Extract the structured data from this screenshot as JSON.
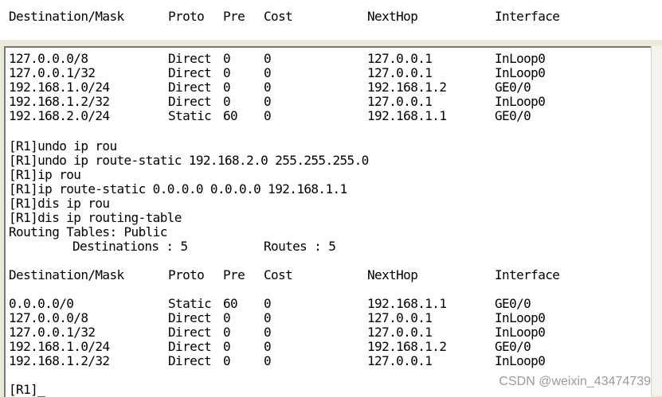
{
  "header": {
    "destination": "Destination/Mask",
    "proto": "Proto",
    "pre": "Pre",
    "cost": "Cost",
    "nexthop": "NextHop",
    "interface": "Interface"
  },
  "table1": [
    {
      "dest": "127.0.0.0/8",
      "proto": "Direct",
      "pre": "0",
      "cost": "0",
      "nexthop": "127.0.0.1",
      "iface": "InLoop0"
    },
    {
      "dest": "127.0.0.1/32",
      "proto": "Direct",
      "pre": "0",
      "cost": "0",
      "nexthop": "127.0.0.1",
      "iface": "InLoop0"
    },
    {
      "dest": "192.168.1.0/24",
      "proto": "Direct",
      "pre": "0",
      "cost": "0",
      "nexthop": "192.168.1.2",
      "iface": "GE0/0"
    },
    {
      "dest": "192.168.1.2/32",
      "proto": "Direct",
      "pre": "0",
      "cost": "0",
      "nexthop": "127.0.0.1",
      "iface": "InLoop0"
    },
    {
      "dest": "192.168.2.0/24",
      "proto": "Static",
      "pre": "60",
      "cost": "0",
      "nexthop": "192.168.1.1",
      "iface": "GE0/0"
    }
  ],
  "commands": [
    "[R1]undo ip rou",
    "[R1]undo ip route-static 192.168.2.0 255.255.255.0",
    "[R1]ip rou",
    "[R1]ip route-static 0.0.0.0 0.0.0.0 192.168.1.1",
    "[R1]dis ip rou",
    "[R1]dis ip routing-table",
    "Routing Tables: Public"
  ],
  "summary": {
    "destinations": "Destinations : 5",
    "routes": "Routes : 5"
  },
  "table2": [
    {
      "dest": "0.0.0.0/0",
      "proto": "Static",
      "pre": "60",
      "cost": "0",
      "nexthop": "192.168.1.1",
      "iface": "GE0/0"
    },
    {
      "dest": "127.0.0.0/8",
      "proto": "Direct",
      "pre": "0",
      "cost": "0",
      "nexthop": "127.0.0.1",
      "iface": "InLoop0"
    },
    {
      "dest": "127.0.0.1/32",
      "proto": "Direct",
      "pre": "0",
      "cost": "0",
      "nexthop": "127.0.0.1",
      "iface": "InLoop0"
    },
    {
      "dest": "192.168.1.0/24",
      "proto": "Direct",
      "pre": "0",
      "cost": "0",
      "nexthop": "192.168.1.2",
      "iface": "GE0/0"
    },
    {
      "dest": "192.168.1.2/32",
      "proto": "Direct",
      "pre": "0",
      "cost": "0",
      "nexthop": "127.0.0.1",
      "iface": "InLoop0"
    }
  ],
  "prompt": "[R1]_",
  "watermark": "CSDN @weixin_43474739"
}
